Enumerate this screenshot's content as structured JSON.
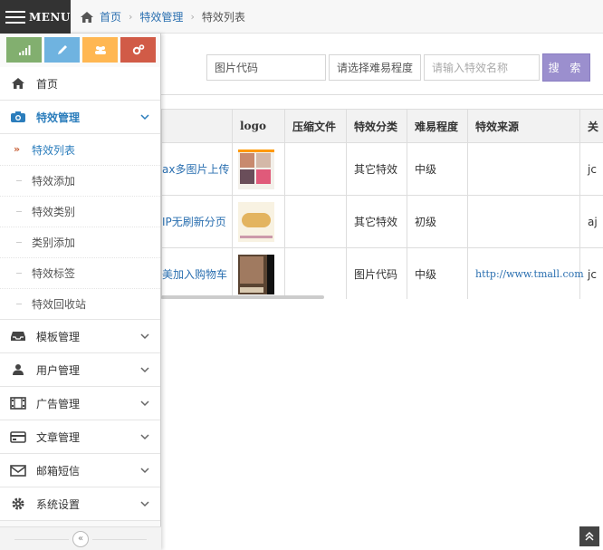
{
  "topbar": {
    "menu_label": "MENU"
  },
  "breadcrumb": {
    "home": "首页",
    "section": "特效管理",
    "current": "特效列表"
  },
  "search": {
    "code_value": "图片代码",
    "difficulty_value": "请选择难易程度",
    "name_placeholder": "请输入特效名称",
    "button_label": "搜 索"
  },
  "table": {
    "headers": {
      "logo": "logo",
      "zip": "压缩文件",
      "category": "特效分类",
      "difficulty": "难易程度",
      "source": "特效来源",
      "extra": "关"
    },
    "rows": [
      {
        "name": "ax多图片上传",
        "zip": "",
        "category": "其它特效",
        "difficulty": "中级",
        "source": "",
        "extra": "jc"
      },
      {
        "name": "IP无刷新分页",
        "zip": "",
        "category": "其它特效",
        "difficulty": "初级",
        "source": "",
        "extra": "aj"
      },
      {
        "name": "美加入购物车",
        "zip": "",
        "category": "图片代码",
        "difficulty": "中级",
        "source": "http://www.tmall.com",
        "extra": "jc"
      }
    ]
  },
  "sidebar": {
    "home": "首页",
    "effects": {
      "label": "特效管理",
      "items": [
        "特效列表",
        "特效添加",
        "特效类别",
        "类别添加",
        "特效标签",
        "特效回收站"
      ]
    },
    "templates": "模板管理",
    "users": "用户管理",
    "ads": "广告管理",
    "articles": "文章管理",
    "mail": "邮箱短信",
    "settings": "系统设置"
  },
  "colors": {
    "accent_blue": "#2b7dbc",
    "search_button": "#9b8fce",
    "shortcut_green": "#82af6f",
    "shortcut_blue": "#6fb3e0",
    "shortcut_orange": "#ffb752",
    "shortcut_red": "#d15b47"
  },
  "icons": {
    "shortcuts": [
      "signal-icon",
      "pencil-icon",
      "users-icon",
      "cogs-icon"
    ],
    "nav": [
      "home-icon",
      "camera-icon",
      "inbox-icon",
      "user-icon",
      "film-icon",
      "credit-card-icon",
      "envelope-icon",
      "gear-icon"
    ]
  }
}
